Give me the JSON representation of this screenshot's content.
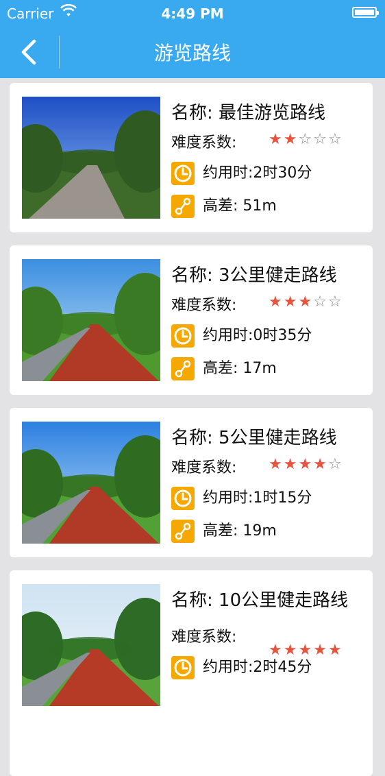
{
  "status": {
    "carrier": "Carrier",
    "time": "4:49 PM"
  },
  "nav": {
    "title": "游览路线"
  },
  "routes": [
    {
      "name": "名称: 最佳游览路线",
      "difficulty_label": "难度系数:",
      "rating": 2,
      "max_rating": 5,
      "time": "约用时:2时30分",
      "elevation": "高差: 51m"
    },
    {
      "name": "名称: 3公里健走路线",
      "difficulty_label": "难度系数:",
      "rating": 3,
      "max_rating": 5,
      "time": "约用时:0时35分",
      "elevation": "高差: 17m"
    },
    {
      "name": "名称: 5公里健走路线",
      "difficulty_label": "难度系数:",
      "rating": 4,
      "max_rating": 5,
      "time": "约用时:1时15分",
      "elevation": "高差: 19m"
    },
    {
      "name": "名称: 10公里健走路线",
      "difficulty_label": "难度系数:",
      "rating": 5,
      "max_rating": 5,
      "time": "约用时:2时45分",
      "elevation": ""
    }
  ],
  "colors": {
    "accent": "#3aaaf0",
    "star_on": "#e4543f",
    "icon_bg": "#f5a800"
  }
}
